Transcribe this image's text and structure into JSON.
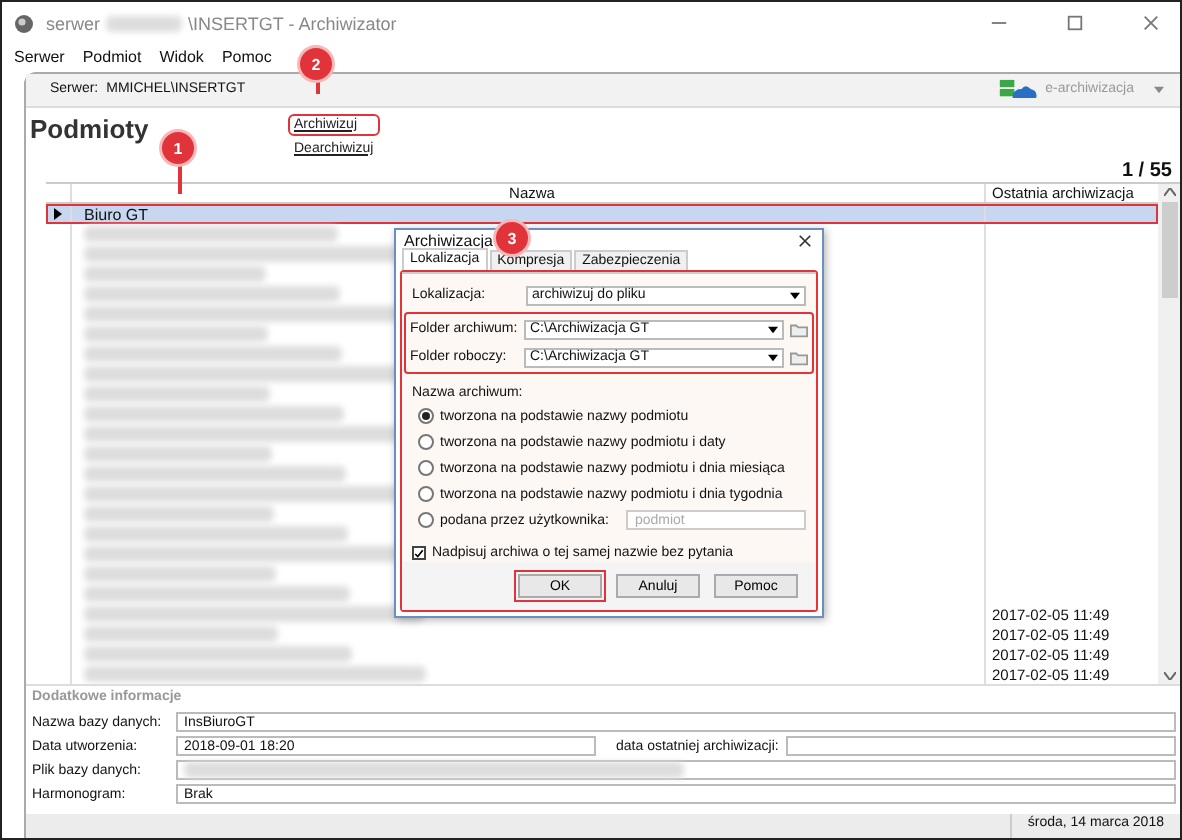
{
  "window": {
    "title_start": "serwer",
    "title_end": "\\INSERTGT - Archiwizator"
  },
  "menu": [
    "Serwer",
    "Podmiot",
    "Widok",
    "Pomoc"
  ],
  "toolbar": {
    "server_label": "Serwer:",
    "server_value": "MMICHEL\\INSERTGT",
    "service": "e-archiwizacja"
  },
  "heading": "Podmioty",
  "links": [
    "Archiwizuj",
    "Dearchiwizuj"
  ],
  "counter": "1 / 55",
  "table": {
    "columns": [
      "Nazwa",
      "Ostatnia archiwizacja"
    ],
    "rows": [
      {
        "name": "Biuro GT",
        "selected": true
      },
      {
        "selected": false
      },
      {
        "selected": false
      },
      {
        "selected": false
      },
      {
        "selected": false
      },
      {
        "selected": false
      },
      {
        "selected": false
      },
      {
        "selected": false
      },
      {
        "selected": false
      },
      {
        "selected": false
      },
      {
        "selected": false
      },
      {
        "selected": false
      },
      {
        "selected": false
      },
      {
        "selected": false
      },
      {
        "selected": false
      },
      {
        "selected": false
      },
      {
        "selected": false
      },
      {
        "selected": false
      },
      {
        "selected": false
      },
      {
        "selected": false
      },
      {
        "selected": false,
        "date": "2017-02-05 11:49"
      },
      {
        "selected": false,
        "date": "2017-02-05 11:49"
      },
      {
        "selected": false,
        "date": "2017-02-05 11:49"
      },
      {
        "selected": false,
        "date": "2017-02-05 11:49"
      }
    ]
  },
  "info": {
    "title": "Dodatkowe informacje",
    "db_name": {
      "label": "Nazwa bazy danych:",
      "value": "InsBiuroGT"
    },
    "created": {
      "label": "Data utworzenia:",
      "value": "2018-09-01 18:20"
    },
    "last_archive": {
      "label": "data ostatniej archiwizacji:"
    },
    "db_file": {
      "label": "Plik bazy danych:"
    },
    "schedule": {
      "label": "Harmonogram:",
      "value": "Brak"
    }
  },
  "status_bar": "środa, 14 marca 2018",
  "dialog": {
    "title": "Archiwizacja",
    "tabs": [
      {
        "label": "Lokalizacja",
        "selected": true
      },
      {
        "label": "Kompresja",
        "selected": false
      },
      {
        "label": "Zabezpieczenia",
        "selected": false
      }
    ],
    "location": {
      "label": "Lokalizacja:",
      "value": "archiwizuj do pliku"
    },
    "folders": [
      {
        "label": "Folder archiwum:",
        "value": "C:\\Archiwizacja GT"
      },
      {
        "label": "Folder roboczy:",
        "value": "C:\\Archiwizacja GT"
      }
    ],
    "group_label": "Nazwa archiwum:",
    "options": [
      {
        "label": "tworzona na podstawie nazwy podmiotu",
        "selected": true
      },
      {
        "label": "tworzona na podstawie nazwy podmiotu i daty",
        "selected": false
      },
      {
        "label": "tworzona na podstawie nazwy podmiotu i dnia miesiąca",
        "selected": false
      },
      {
        "label": "tworzona na podstawie nazwy podmiotu i dnia tygodnia",
        "selected": false
      },
      {
        "label": "podana przez użytkownika:",
        "selected": false,
        "placeholder": "podmiot"
      }
    ],
    "overwrite": {
      "label": "Nadpisuj archiwa o tej samej nazwie bez pytania",
      "checked": true
    },
    "buttons": [
      "OK",
      "Anuluj",
      "Pomoc"
    ]
  },
  "annotations": [
    "1",
    "2",
    "3"
  ]
}
